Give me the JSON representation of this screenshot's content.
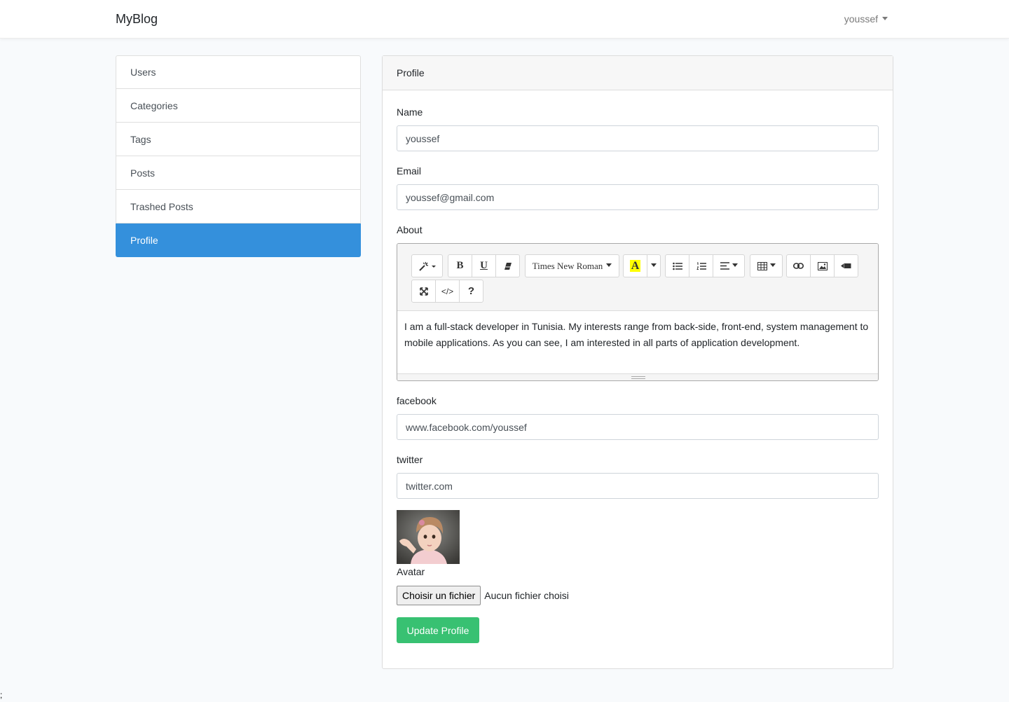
{
  "navbar": {
    "brand": "MyBlog",
    "user": "youssef"
  },
  "sidebar": {
    "items": [
      {
        "label": "Users"
      },
      {
        "label": "Categories"
      },
      {
        "label": "Tags"
      },
      {
        "label": "Posts"
      },
      {
        "label": "Trashed Posts"
      },
      {
        "label": "Profile",
        "active": true
      }
    ]
  },
  "card": {
    "title": "Profile",
    "fields": {
      "name": {
        "label": "Name",
        "value": "youssef"
      },
      "email": {
        "label": "Email",
        "value": "youssef@gmail.com"
      },
      "about": {
        "label": "About",
        "value": "I am a full-stack developer in Tunisia. My interests range from back-side, front-end, system management to mobile applications. As you can see, I am interested in all parts of application development."
      },
      "facebook": {
        "label": "facebook",
        "value": "www.facebook.com/youssef"
      },
      "twitter": {
        "label": "twitter",
        "value": "twitter.com"
      }
    },
    "editor": {
      "font_name": "Times New Roman",
      "icons": [
        "magic-icon",
        "bold-icon",
        "underline-icon",
        "eraser-icon",
        "font-color-icon",
        "unordered-list-icon",
        "ordered-list-icon",
        "align-icon",
        "table-icon",
        "link-icon",
        "picture-icon",
        "video-icon",
        "fullscreen-icon",
        "code-view-icon",
        "help-icon"
      ]
    },
    "avatar": {
      "label": "Avatar"
    },
    "file": {
      "button_label": "Choisir un fichier",
      "status": "Aucun fichier choisi"
    },
    "submit_label": "Update Profile"
  },
  "colors": {
    "primary": "#3490dc",
    "success": "#38c172",
    "background": "#f8fafc",
    "highlight": "#ffff00"
  },
  "stray_text": ";"
}
